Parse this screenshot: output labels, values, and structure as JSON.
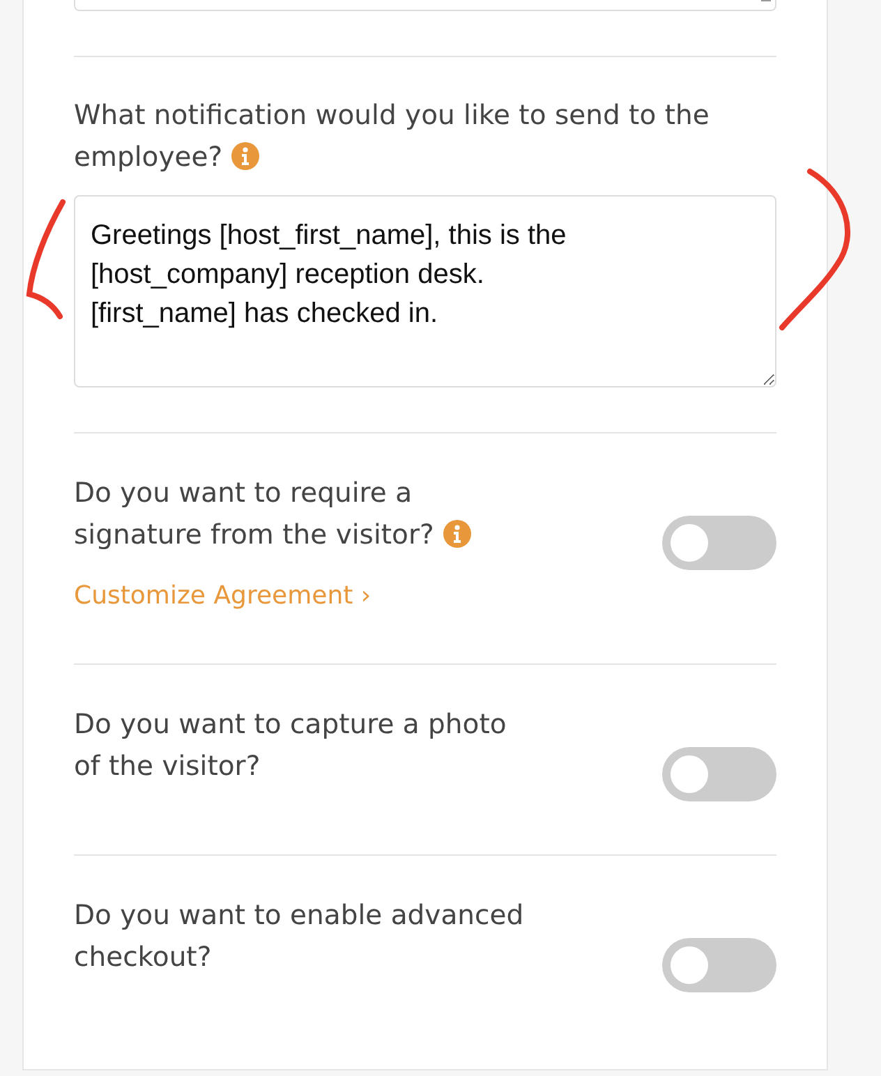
{
  "notification": {
    "question": "What notification would you like to send to the employee?",
    "info": true,
    "message": "Greetings [host_first_name], this is the [host_company] reception desk.\n[first_name] has checked in."
  },
  "settings": [
    {
      "question": "Do you want to require a signature from the visitor?",
      "info": true,
      "link": "Customize Agreement ›",
      "on": false
    },
    {
      "question": "Do you want to capture a photo of the visitor?",
      "info": false,
      "on": false
    },
    {
      "question": "Do you want to enable advanced checkout?",
      "info": false,
      "on": false
    }
  ],
  "annotation": {
    "brackets": true
  }
}
